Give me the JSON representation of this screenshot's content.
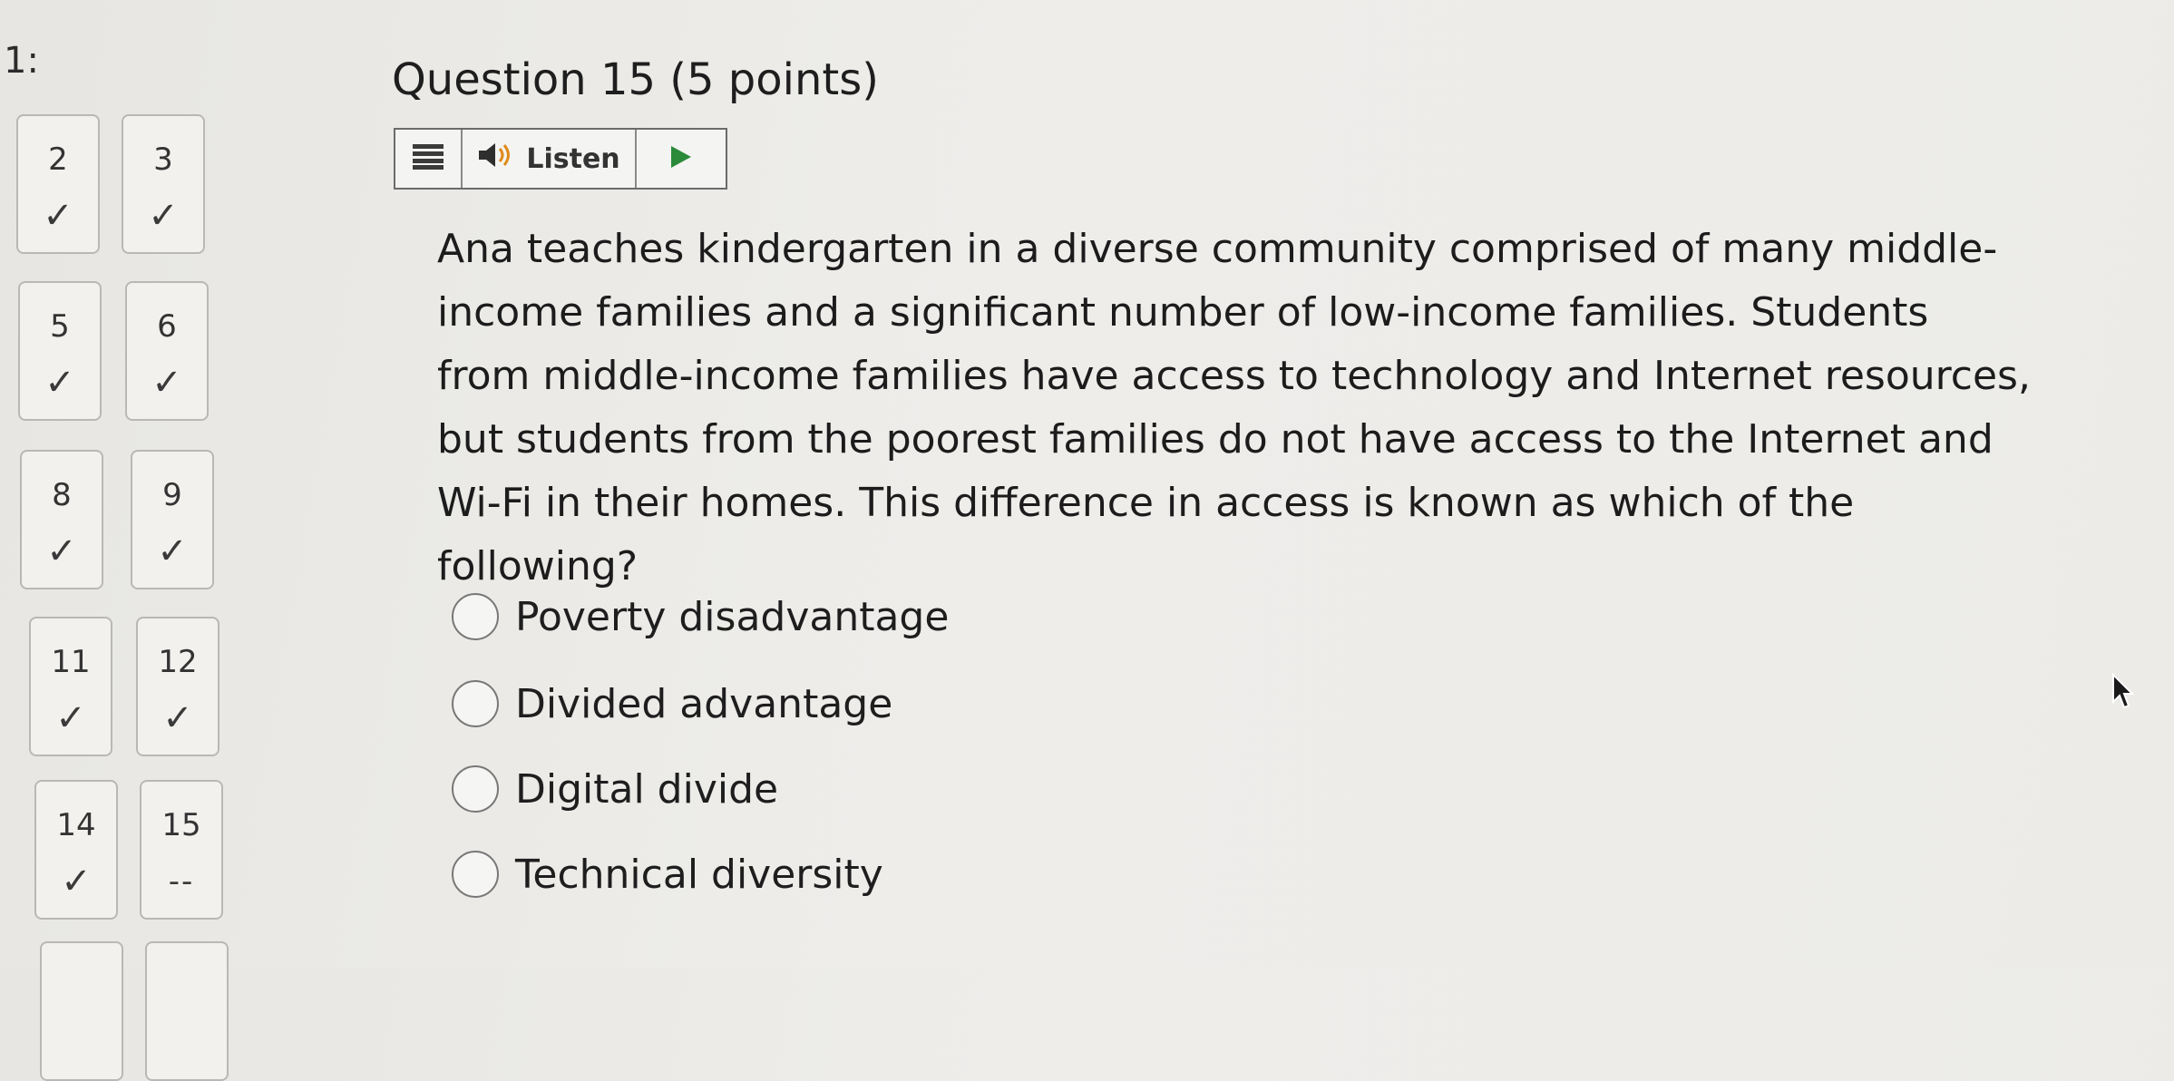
{
  "section_label": "1:",
  "nav": {
    "questions": [
      {
        "number": "2",
        "status": "✓"
      },
      {
        "number": "3",
        "status": "✓"
      },
      {
        "number": "5",
        "status": "✓"
      },
      {
        "number": "6",
        "status": "✓"
      },
      {
        "number": "8",
        "status": "✓"
      },
      {
        "number": "9",
        "status": "✓"
      },
      {
        "number": "11",
        "status": "✓"
      },
      {
        "number": "12",
        "status": "✓"
      },
      {
        "number": "14",
        "status": "✓"
      },
      {
        "number": "15",
        "status": "--"
      }
    ]
  },
  "question": {
    "title": "Question 15 (5 points)",
    "listen_label": "Listen",
    "text": "Ana teaches kindergarten in a diverse community comprised of many middle-income families and a significant number of low-income families. Students from middle-income families have access to technology and Internet resources, but students from the poorest families do not have access to the Internet and Wi-Fi in their homes. This difference in access is known as which of the following?",
    "options": [
      "Poverty disadvantage",
      "Divided advantage",
      "Digital divide",
      "Technical diversity"
    ]
  },
  "icons": {
    "menu": "menu-icon",
    "speaker": "speaker-icon",
    "play": "play-icon",
    "cursor": "mouse-cursor-icon"
  }
}
